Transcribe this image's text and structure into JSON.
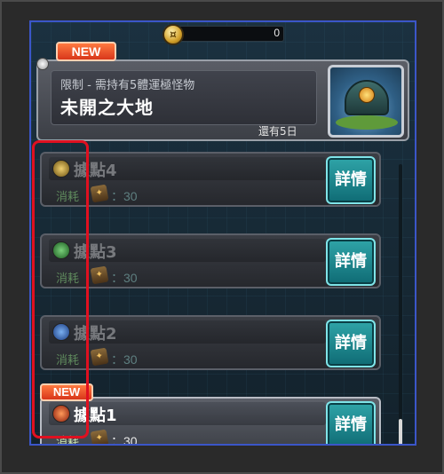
{
  "currency": {
    "count": "0",
    "icon": "coin-icon"
  },
  "header": {
    "new_badge": "NEW",
    "condition": "限制 - 需持有5體運極怪物",
    "title": "未開之大地",
    "remaining": "還有5日"
  },
  "bases": [
    {
      "name": "據點4",
      "cost_label": "消耗",
      "cost_value": "：30",
      "detail_label": "詳情",
      "icon_color": "#b08a2a",
      "active": false
    },
    {
      "name": "據點3",
      "cost_label": "消耗",
      "cost_value": "：30",
      "detail_label": "詳情",
      "icon_color": "#2f8a3a",
      "active": false
    },
    {
      "name": "據點2",
      "cost_label": "消耗",
      "cost_value": "：30",
      "detail_label": "詳情",
      "icon_color": "#2a5ab0",
      "active": false
    },
    {
      "name": "據點1",
      "cost_label": "消耗",
      "cost_value": "：30",
      "detail_label": "詳情",
      "icon_color": "#d03a1a",
      "active": true,
      "new_badge": "NEW"
    }
  ],
  "colors": {
    "accent_new": "#e0431f",
    "detail_button": "#1d8b93",
    "highlight": "#e01020"
  }
}
